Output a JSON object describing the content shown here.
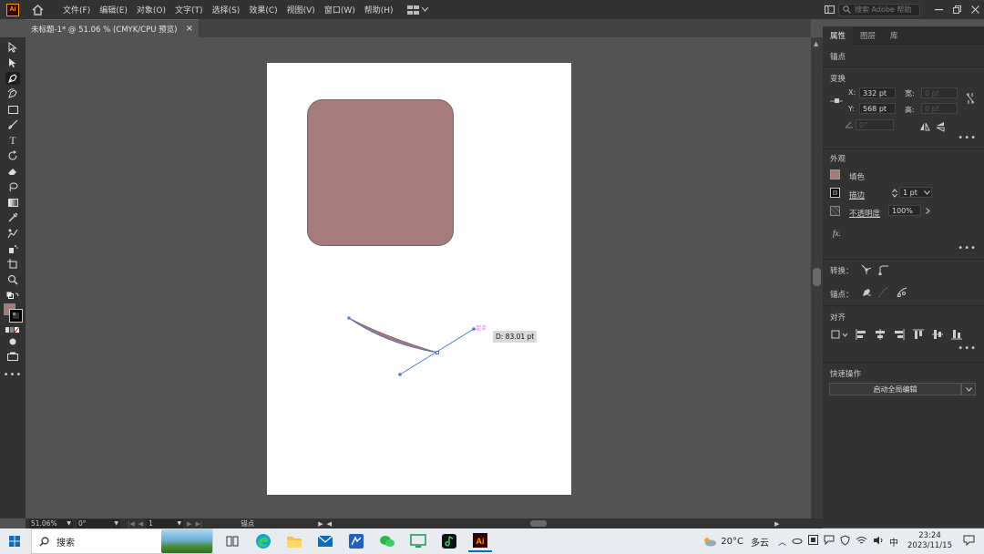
{
  "app": {
    "logo": "Ai"
  },
  "menu": [
    "文件(F)",
    "编辑(E)",
    "对象(O)",
    "文字(T)",
    "选择(S)",
    "效果(C)",
    "视图(V)",
    "窗口(W)",
    "帮助(H)"
  ],
  "search": {
    "placeholder": "搜索 Adobe 帮助"
  },
  "document_tab": {
    "title": "未标题-1* @ 51.06 % (CMYK/CPU 预览)",
    "close": "×"
  },
  "tools": [
    "selection-tool",
    "direct-selection-tool",
    "pen-tool",
    "curvature-tool",
    "rectangle-tool",
    "paintbrush-tool",
    "type-tool",
    "rotate-tool",
    "eraser-tool",
    "lasso-tool",
    "gradient-tool",
    "eyedropper-tool",
    "blend-tool",
    "symbol-sprayer-tool",
    "artboard-tool",
    "zoom-tool"
  ],
  "canvas": {
    "tooltip_label": "D: 83.01 pt",
    "anchor_hint": "定点",
    "shape_fill": "#a57b7b",
    "path_color": "#4a78d4"
  },
  "panel": {
    "tabs": [
      "属性",
      "图层",
      "库"
    ],
    "selection_type": "锚点",
    "transform": {
      "title": "变换",
      "x_label": "X:",
      "x_value": "332 pt",
      "y_label": "Y:",
      "y_value": "568 pt",
      "w_label": "宽:",
      "h_label": "高:",
      "w_value": "0 pt",
      "h_value": "0 pt",
      "angle_value": "0°"
    },
    "appearance": {
      "title": "外观",
      "fill_label": "填色",
      "stroke_label": "描边",
      "stroke_value": "1 pt",
      "opacity_label": "不透明度",
      "opacity_value": "100%",
      "fx": "fx."
    },
    "convert": {
      "title": "转换："
    },
    "anchor": {
      "title": "锚点："
    },
    "align": {
      "title": "对齐"
    },
    "quick_actions": {
      "title": "快速操作",
      "global_edit_button": "启动全局编辑"
    }
  },
  "statusbar": {
    "zoom": "51.06%",
    "rotation": "0°",
    "artboard_num": "1",
    "status_text": "锚点"
  },
  "taskbar": {
    "search_placeholder": "搜索",
    "weather_temp": "20°C",
    "weather_desc": "多云",
    "ime": "中",
    "time": "23:24",
    "date": "2023/11/15"
  }
}
